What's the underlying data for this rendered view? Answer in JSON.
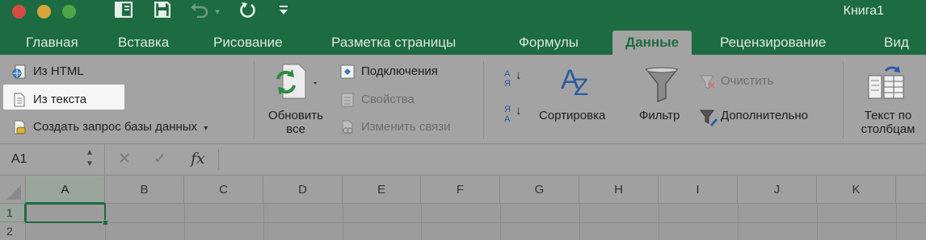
{
  "window": {
    "title": "Книга1"
  },
  "tabs": [
    {
      "label": "Главная"
    },
    {
      "label": "Вставка"
    },
    {
      "label": "Рисование"
    },
    {
      "label": "Разметка страницы"
    },
    {
      "label": "Формулы"
    },
    {
      "label": "Данные",
      "active": true
    },
    {
      "label": "Рецензирование"
    },
    {
      "label": "Вид"
    }
  ],
  "ribbon": {
    "get_data": {
      "from_html": "Из HTML",
      "from_text": "Из текста",
      "new_db_query": "Создать запрос базы данных"
    },
    "connections": {
      "refresh_all_line1": "Обновить",
      "refresh_all_line2": "все",
      "connections": "Подключения",
      "properties": "Свойства",
      "edit_links": "Изменить связи"
    },
    "sort_filter": {
      "sort_az_top": "А",
      "sort_az_bottom": "Я",
      "sort_za_top": "Я",
      "sort_za_bottom": "А",
      "sort_big_a": "А",
      "sort_big_z": "Z",
      "sort": "Сортировка",
      "filter": "Фильтр",
      "clear": "Очистить",
      "advanced": "Дополнительно"
    },
    "data_tools": {
      "text_to_columns_line1": "Текст по",
      "text_to_columns_line2": "столбцам"
    }
  },
  "formula_bar": {
    "name_box": "A1",
    "fx": "fx",
    "formula": ""
  },
  "grid": {
    "columns": [
      "A",
      "B",
      "C",
      "D",
      "E",
      "F",
      "G",
      "H",
      "I",
      "J",
      "K"
    ],
    "rows": [
      "1",
      "2"
    ],
    "active_cell": "A1"
  },
  "colors": {
    "accent": "#1d6b41",
    "ribbon_bg": "#a3a3a3",
    "highlight": "#f6f6f6"
  }
}
